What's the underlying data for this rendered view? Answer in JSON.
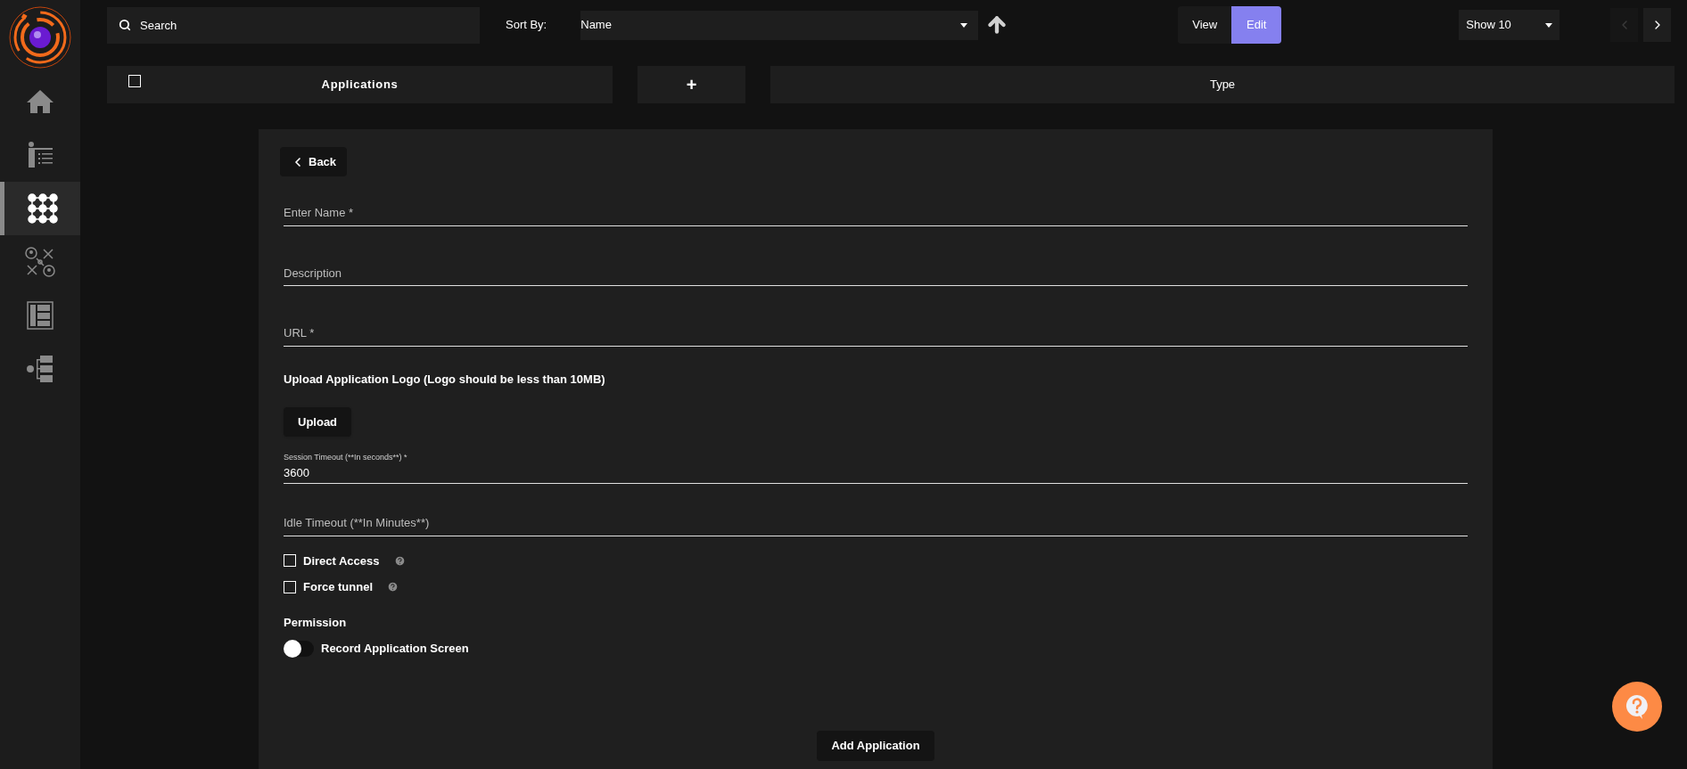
{
  "sidebar": {
    "items": [
      {
        "selected": false
      },
      {
        "selected": false
      },
      {
        "selected": true
      },
      {
        "selected": false
      },
      {
        "selected": false
      },
      {
        "selected": false
      }
    ]
  },
  "toolbar": {
    "search": {
      "placeholder": "Search"
    },
    "sort_label": "Sort By:",
    "sort_value": "Name",
    "modes": [
      {
        "label": "View",
        "selected": false
      },
      {
        "label": "Edit",
        "selected": true
      }
    ],
    "show": "Show 10",
    "pager": [
      {
        "disabled": true
      },
      {
        "disabled": false
      }
    ]
  },
  "table_header": {
    "select_all": {
      "checked": false
    },
    "columns": [
      {
        "kind": "title",
        "label": "Applications"
      },
      {
        "kind": "add",
        "label": "+"
      },
      {
        "kind": "title",
        "label": "Type"
      }
    ]
  },
  "form": {
    "back": "Back",
    "fields": [
      {
        "kind": "input",
        "placeholder": "Enter Name *"
      },
      {
        "kind": "input",
        "placeholder": "Description"
      },
      {
        "kind": "input",
        "placeholder": "URL *"
      },
      {
        "kind": "upload",
        "label": "Upload Application Logo (Logo should be less than 10MB)",
        "button": "Upload"
      },
      {
        "kind": "filled",
        "label": "Session Timeout (**In seconds**) *",
        "value": "3600"
      },
      {
        "kind": "input",
        "placeholder": "Idle Timeout (**In Minutes**)"
      }
    ],
    "options": [
      {
        "label": "Direct Access",
        "checked": false
      },
      {
        "label": "Force tunnel",
        "checked": false
      }
    ],
    "permission": {
      "title": "Permission",
      "toggles": [
        {
          "label": "Record Application Screen",
          "on": false
        }
      ]
    },
    "submit": "Add Application"
  }
}
